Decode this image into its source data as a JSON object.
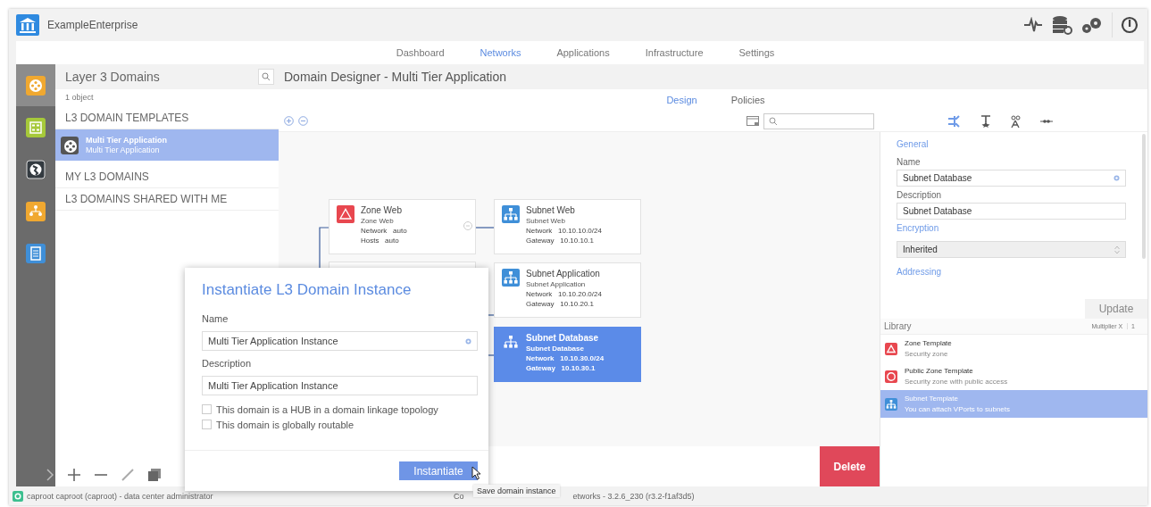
{
  "app": {
    "name": "ExampleEnterprise"
  },
  "nav": [
    {
      "label": "Dashboard",
      "selected": false
    },
    {
      "label": "Networks",
      "selected": true
    },
    {
      "label": "Applications",
      "selected": false
    },
    {
      "label": "Infrastructure",
      "selected": false
    },
    {
      "label": "Settings",
      "selected": false
    }
  ],
  "rail": [
    {
      "kind": "domain",
      "color": "#f0a830",
      "selected": true
    },
    {
      "kind": "grid",
      "color": "#a6c93a",
      "selected": false
    },
    {
      "kind": "globe",
      "color": "#333a40",
      "selected": false
    },
    {
      "kind": "org",
      "color": "#f0a830",
      "selected": false
    },
    {
      "kind": "doc",
      "color": "#3f8fd8",
      "selected": false
    }
  ],
  "list_panel": {
    "title": "Layer 3 Domains",
    "count": "1 object",
    "sections": [
      {
        "heading": "L3 DOMAIN TEMPLATES",
        "items": [
          {
            "title": "Multi Tier Application",
            "subtitle": "Multi Tier Application",
            "selected": true
          }
        ]
      },
      {
        "heading": "MY L3 DOMAINS"
      },
      {
        "heading": "L3 DOMAINS SHARED WITH ME"
      }
    ]
  },
  "designer": {
    "title": "Domain Designer - Multi Tier Application",
    "tabs": [
      {
        "label": "Design",
        "selected": true
      },
      {
        "label": "Policies",
        "selected": false
      }
    ],
    "nodes": [
      {
        "kind": "zone",
        "title": "Zone Web",
        "subtitle": "Zone Web",
        "selected": false,
        "fields": [
          {
            "label": "Network",
            "value": "auto"
          },
          {
            "label": "Hosts",
            "value": "auto"
          }
        ]
      },
      {
        "kind": "subnet",
        "title": "Subnet Web",
        "subtitle": "Subnet Web",
        "selected": false,
        "fields": [
          {
            "label": "Network",
            "value": "10.10.10.0/24"
          },
          {
            "label": "Gateway",
            "value": "10.10.10.1"
          }
        ]
      },
      {
        "kind": "subnet",
        "title": "Subnet Application",
        "subtitle": "Subnet Application",
        "selected": false,
        "fields": [
          {
            "label": "Network",
            "value": "10.10.20.0/24"
          },
          {
            "label": "Gateway",
            "value": "10.10.20.1"
          }
        ]
      },
      {
        "kind": "subnet",
        "title": "Subnet Database",
        "subtitle": "Subnet Database",
        "selected": true,
        "fields": [
          {
            "label": "Network",
            "value": "10.10.30.0/24"
          },
          {
            "label": "Gateway",
            "value": "10.10.30.1"
          }
        ]
      }
    ],
    "delete_button": "Delete"
  },
  "properties": {
    "sections": [
      {
        "heading": "General",
        "fields": [
          {
            "kind": "text",
            "label": "Name",
            "value": "Subnet Database",
            "clearable": true
          },
          {
            "kind": "text",
            "label": "Description",
            "value": "Subnet Database",
            "clearable": false
          }
        ]
      },
      {
        "heading": "Encryption",
        "fields": [
          {
            "kind": "select",
            "value": "Inherited"
          }
        ]
      },
      {
        "heading": "Addressing"
      }
    ],
    "update_button": "Update"
  },
  "library": {
    "title": "Library",
    "multiplier_label": "Multiplier X",
    "multiplier_value": "1",
    "items": [
      {
        "kind": "zone",
        "title": "Zone Template",
        "subtitle": "Security zone",
        "selected": false
      },
      {
        "kind": "public-zone",
        "title": "Public Zone Template",
        "subtitle": "Security zone with public access",
        "selected": false
      },
      {
        "kind": "subnet",
        "title": "Subnet Template",
        "subtitle": "You can attach VPorts to subnets",
        "selected": true
      }
    ]
  },
  "dialog": {
    "title": "Instantiate L3 Domain Instance",
    "fields": [
      {
        "label": "Name",
        "value": "Multi Tier Application Instance",
        "clearable": true
      },
      {
        "label": "Description",
        "value": "Multi Tier Application Instance",
        "clearable": false
      }
    ],
    "checkboxes": [
      {
        "label": "This domain is a HUB in a domain linkage topology",
        "checked": false
      },
      {
        "label": "This domain is globally routable",
        "checked": false
      }
    ],
    "button": "Instantiate",
    "tooltip": "Save domain instance"
  },
  "status_bar": {
    "user": "caproot caproot (caproot) - data center administrator",
    "version_parts": [
      "Co",
      "etworks - 3.2.6_230 (r3.2-f1af3d5)"
    ]
  }
}
